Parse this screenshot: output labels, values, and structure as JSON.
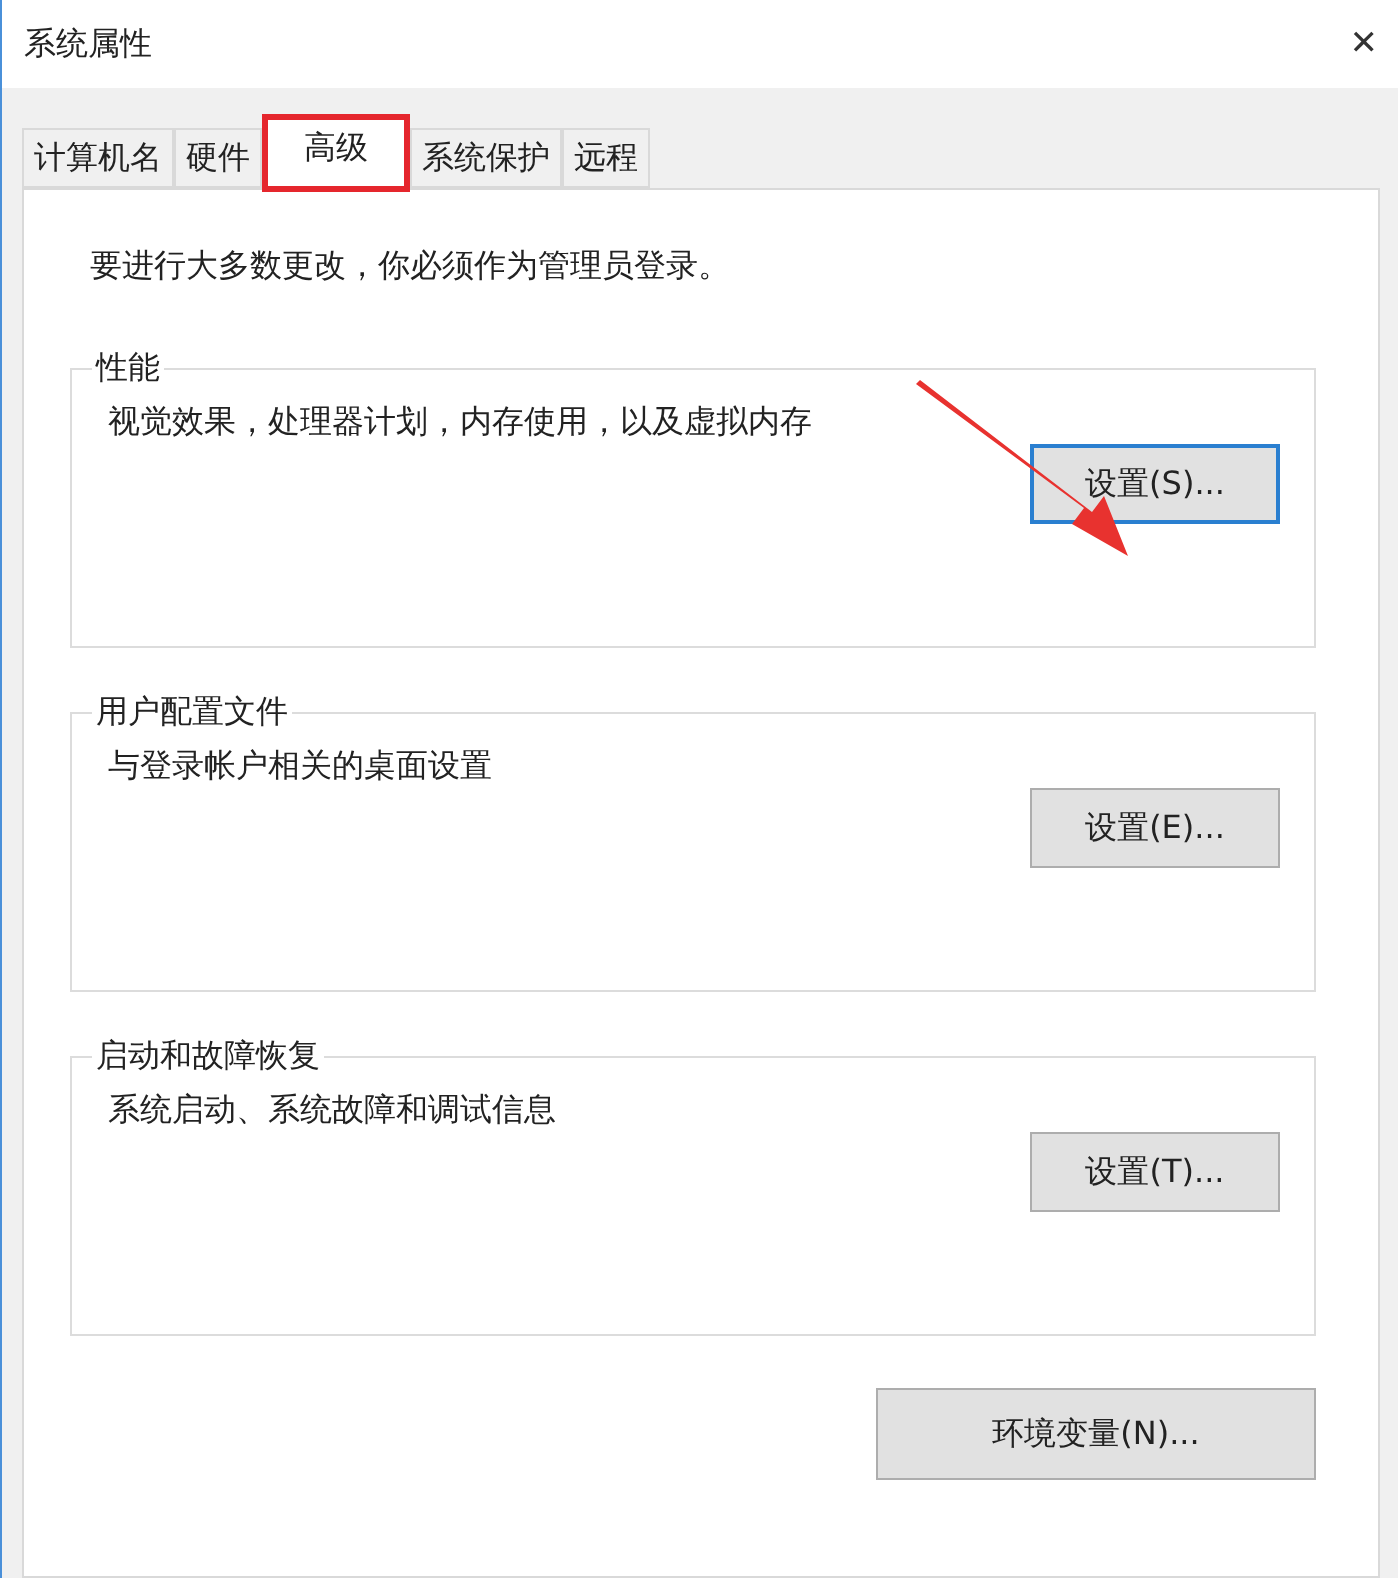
{
  "window": {
    "title": "系统属性",
    "close": "✕"
  },
  "tabs": [
    {
      "label": "计算机名",
      "selected": false,
      "highlighted": false
    },
    {
      "label": "硬件",
      "selected": false,
      "highlighted": false
    },
    {
      "label": "高级",
      "selected": true,
      "highlighted": true
    },
    {
      "label": "系统保护",
      "selected": false,
      "highlighted": false
    },
    {
      "label": "远程",
      "selected": false,
      "highlighted": false
    }
  ],
  "notice": "要进行大多数更改，你必须作为管理员登录。",
  "groups": [
    {
      "title": "性能",
      "description": "视觉效果，处理器计划，内存使用，以及虚拟内存",
      "button": "设置(S)...",
      "focused": true,
      "arrow": true
    },
    {
      "title": "用户配置文件",
      "description": "与登录帐户相关的桌面设置",
      "button": "设置(E)...",
      "focused": false,
      "arrow": false
    },
    {
      "title": "启动和故障恢复",
      "description": "系统启动、系统故障和调试信息",
      "button": "设置(T)...",
      "focused": false,
      "arrow": false
    }
  ],
  "bottom_button": "环境变量(N)..."
}
